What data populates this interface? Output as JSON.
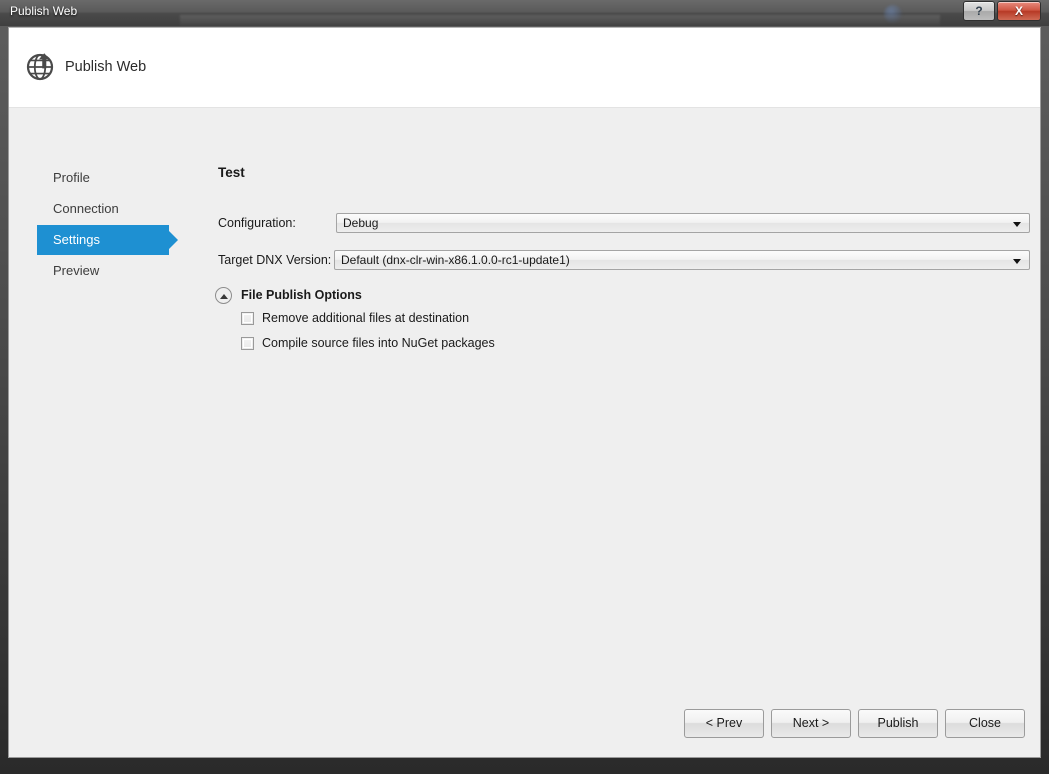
{
  "window": {
    "title": "Publish Web",
    "ghost_text": "",
    "caption_buttons": [
      {
        "name": "help-button",
        "label": "?"
      },
      {
        "name": "close-button",
        "label": "X"
      }
    ]
  },
  "header": {
    "title": "Publish Web",
    "icon": "globe-publish-icon"
  },
  "sidebar": {
    "items": [
      {
        "label": "Profile",
        "selected": false
      },
      {
        "label": "Connection",
        "selected": false
      },
      {
        "label": "Settings",
        "selected": true
      },
      {
        "label": "Preview",
        "selected": false
      }
    ]
  },
  "main": {
    "page_title": "Test",
    "fields": [
      {
        "label": "Configuration:",
        "value": "Debug",
        "name": "configuration"
      },
      {
        "label": "Target DNX Version:",
        "value": "Default (dnx-clr-win-x86.1.0.0-rc1-update1)",
        "name": "target-dnx-version"
      }
    ],
    "expander": {
      "label": "File Publish Options",
      "expanded": true,
      "icon": "chevron-up-icon"
    },
    "checkboxes": [
      {
        "label": "Remove additional files at destination",
        "checked": false,
        "name": "remove-additional-files"
      },
      {
        "label": "Compile source files into NuGet packages",
        "checked": false,
        "name": "compile-into-nuget"
      }
    ]
  },
  "footer": {
    "buttons": [
      {
        "label": "< Prev",
        "name": "prev-button"
      },
      {
        "label": "Next >",
        "name": "next-button"
      },
      {
        "label": "Publish",
        "name": "publish-button"
      },
      {
        "label": "Close",
        "name": "close-dialog-button"
      }
    ]
  },
  "colors": {
    "accent": "#1e90d2",
    "close_red": "#cf5744",
    "panel_bg": "#efefef"
  }
}
